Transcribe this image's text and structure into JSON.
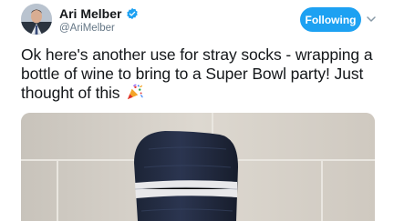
{
  "author": {
    "display_name": "Ari Melber",
    "handle": "@AriMelber",
    "verified": true
  },
  "follow_button": {
    "label": "Following"
  },
  "tweet": {
    "text": "Ok here's another use for stray socks - wrapping a bottle of wine to bring to a Super Bowl party! Just thought of this",
    "emoji": "party-popper-icon"
  },
  "colors": {
    "brand_blue": "#1da1f2",
    "text_primary": "#14171a",
    "text_secondary": "#657786"
  }
}
